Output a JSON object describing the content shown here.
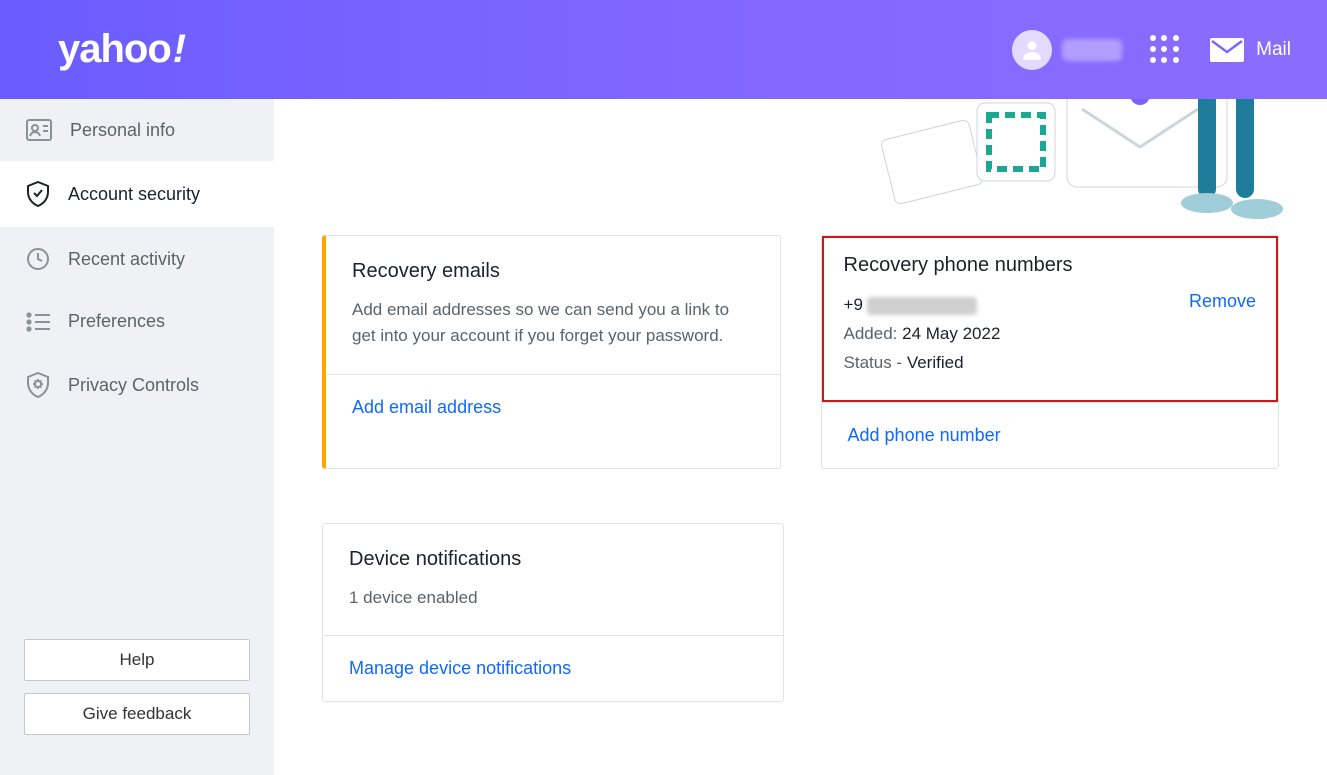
{
  "header": {
    "logo_text": "yahoo",
    "logo_bang": "!",
    "mail_label": "Mail"
  },
  "sidebar": {
    "items": [
      {
        "label": "Personal info"
      },
      {
        "label": "Account security"
      },
      {
        "label": "Recent activity"
      },
      {
        "label": "Preferences"
      },
      {
        "label": "Privacy Controls"
      }
    ],
    "help_label": "Help",
    "feedback_label": "Give feedback"
  },
  "recovery_emails": {
    "title": "Recovery emails",
    "description": "Add email addresses so we can send you a link to get into your account if you forget your password.",
    "action": "Add email address"
  },
  "recovery_phones": {
    "title": "Recovery phone numbers",
    "number_prefix": "+9",
    "added_label": "Added: ",
    "added_value": "24 May 2022",
    "status_label": "Status - ",
    "status_value": "Verified",
    "remove_label": "Remove",
    "add_action": "Add phone number"
  },
  "device_notifications": {
    "title": "Device notifications",
    "subline": "1 device enabled",
    "action": "Manage device notifications"
  }
}
